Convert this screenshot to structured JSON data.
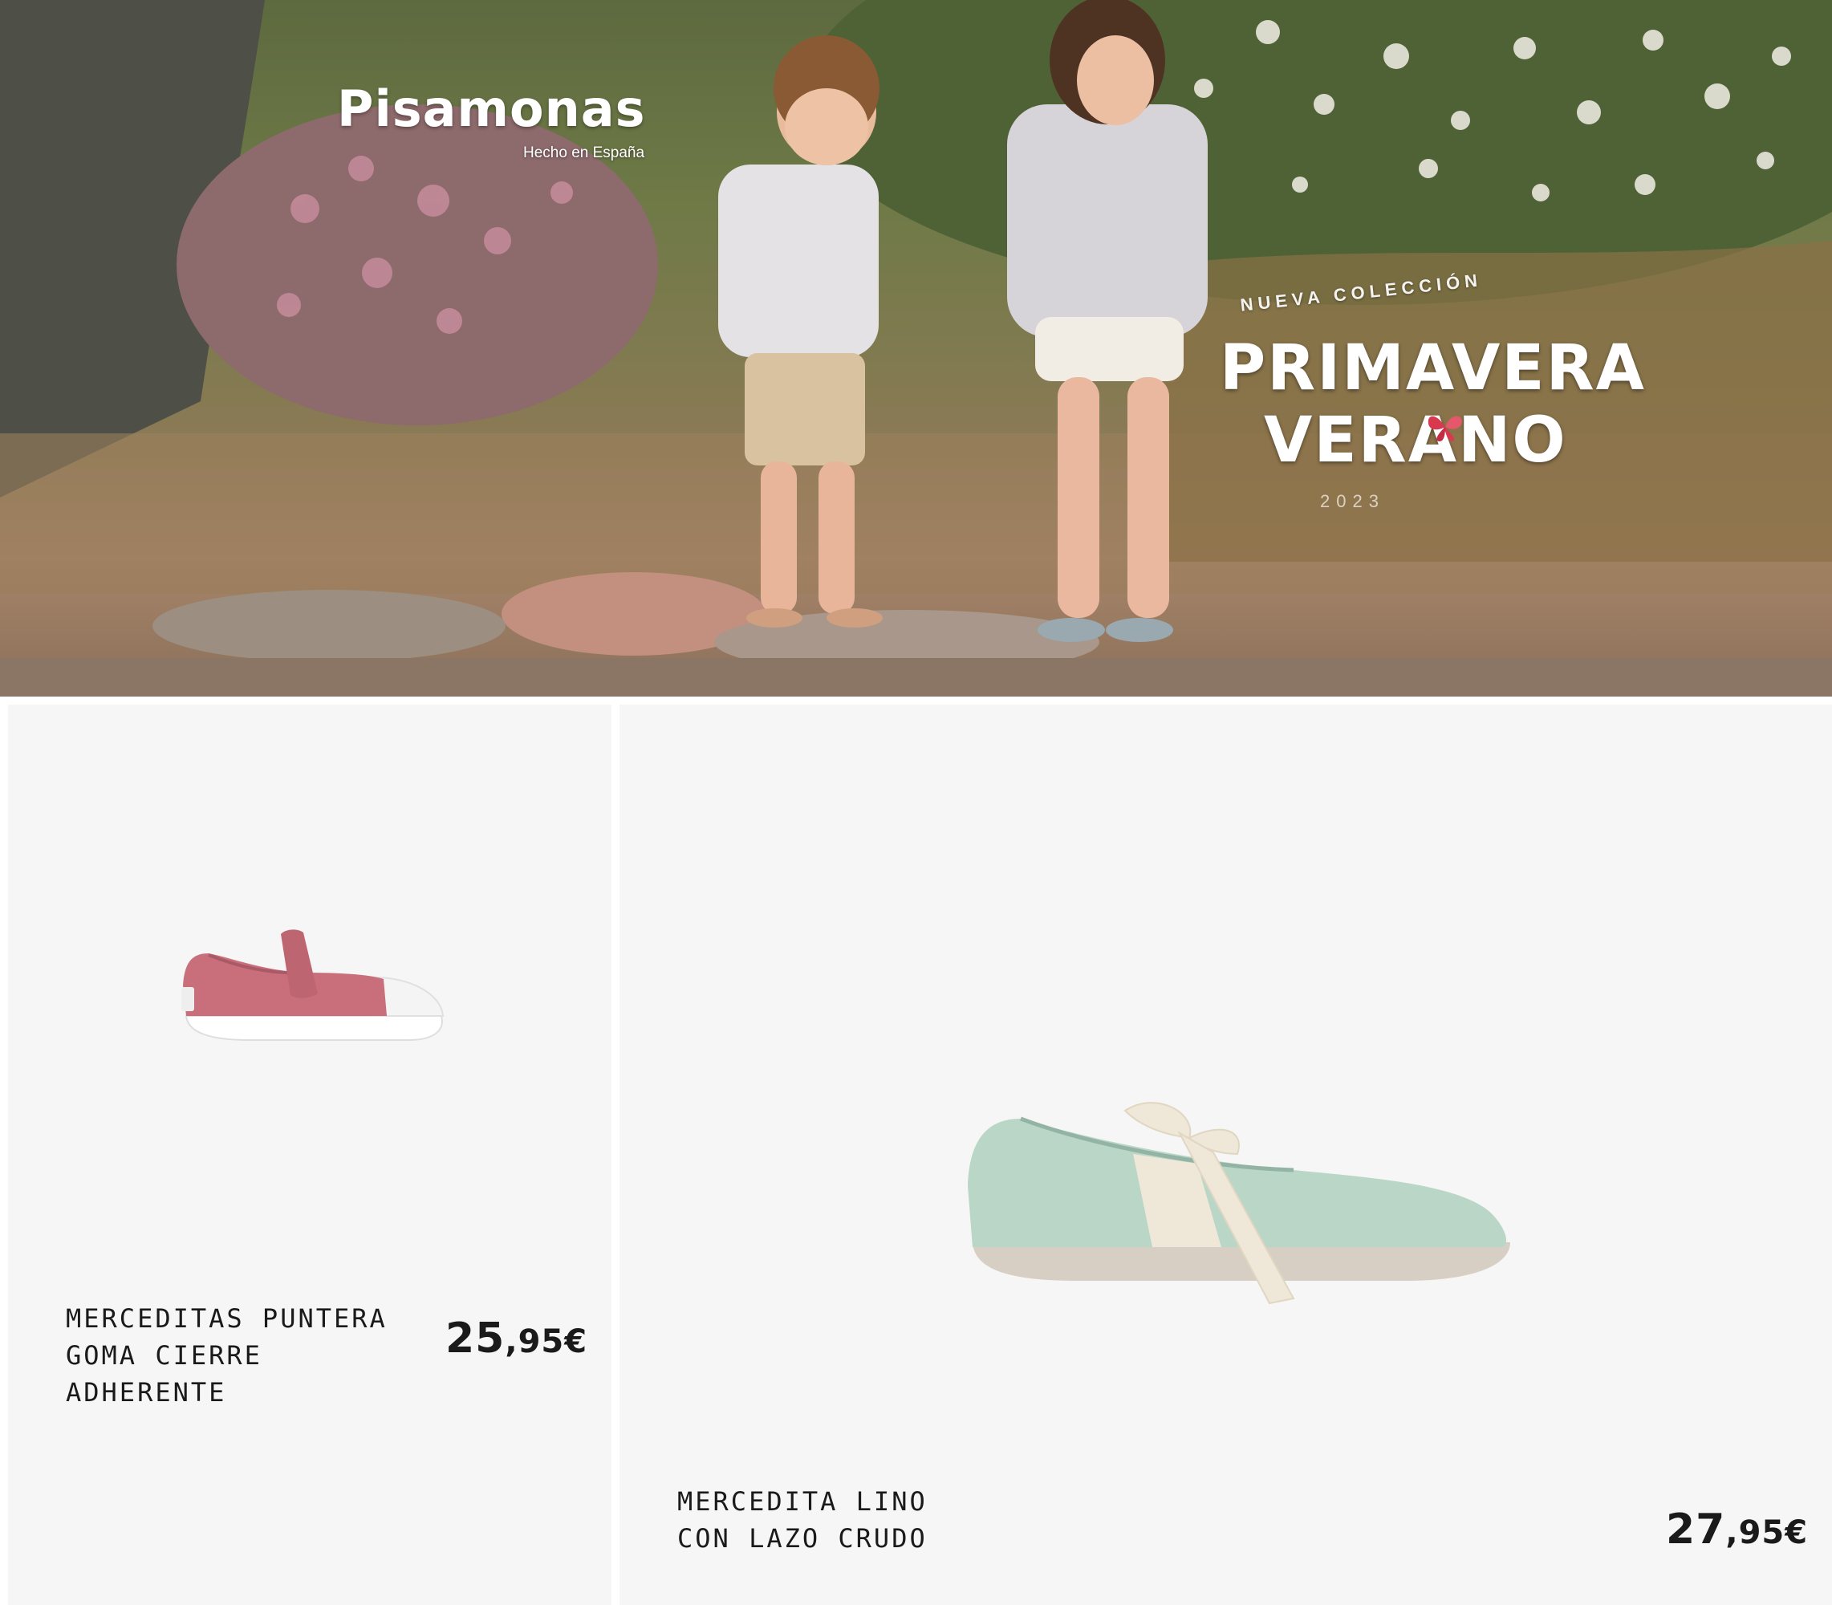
{
  "hero": {
    "brand": "Pisamonas",
    "brand_tagline": "Hecho en España",
    "collection_label": "NUEVA COLECCIÓN",
    "season_line1": "PRIMAVERA",
    "season_line2": "VERANO",
    "season_year": "2023",
    "accent_color": "#d8394f"
  },
  "products": [
    {
      "name": "MERCEDITAS PUNTERA GOMA CIERRE ADHERENTE",
      "price_int": "25",
      "price_dec": ",95€",
      "shoe_color": "#c96f7b"
    },
    {
      "name": "MERCEDITA LINO CON LAZO CRUDO",
      "price_int": "27",
      "price_dec": ",95€",
      "shoe_color": "#b9d6c6"
    }
  ]
}
